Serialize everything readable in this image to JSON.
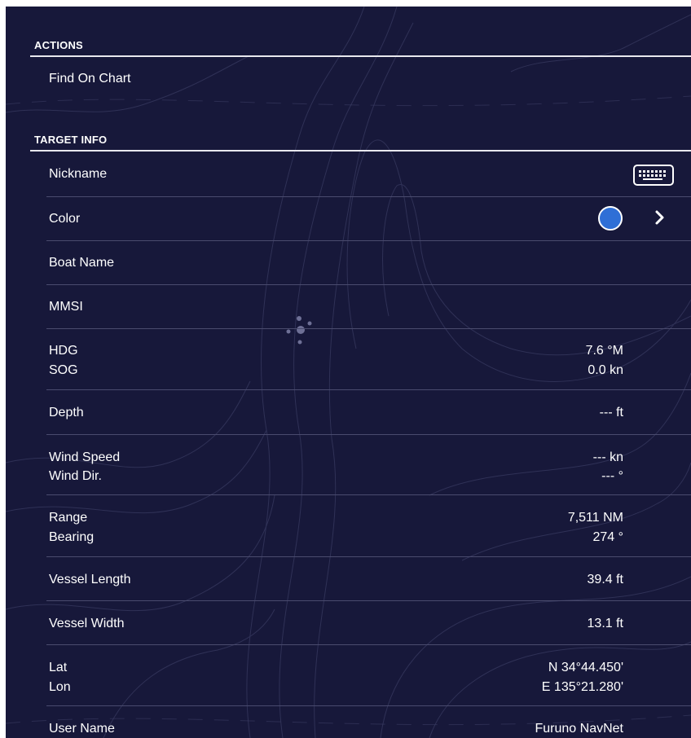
{
  "sections": {
    "actions": "ACTIONS",
    "target_info": "TARGET INFO"
  },
  "actions": {
    "find_on_chart": "Find On Chart"
  },
  "target_info": {
    "nickname": "Nickname",
    "color": "Color",
    "color_value": "#2f6fd6",
    "boat_name": "Boat Name",
    "mmsi": "MMSI",
    "hdg_label": "HDG",
    "hdg_value": "7.6 °M",
    "sog_label": "SOG",
    "sog_value": "0.0 kn",
    "depth_label": "Depth",
    "depth_value": "--- ft",
    "wind_speed_label": "Wind Speed",
    "wind_speed_value": "--- kn",
    "wind_dir_label": "Wind Dir.",
    "wind_dir_value": "--- °",
    "range_label": "Range",
    "range_value": "7,511 NM",
    "bearing_label": "Bearing",
    "bearing_value": "274 °",
    "vessel_length_label": "Vessel Length",
    "vessel_length_value": "39.4 ft",
    "vessel_width_label": "Vessel Width",
    "vessel_width_value": "13.1 ft",
    "lat_label": "Lat",
    "lat_value": "N 34°44.450'",
    "lon_label": "Lon",
    "lon_value": "E 135°21.280'",
    "user_name_label": "User Name",
    "user_name_value": "Furuno NavNet"
  },
  "icons": {
    "keyboard": "keyboard-icon",
    "chevron": "chevron-right-icon",
    "spinner": "loading-spinner-icon"
  },
  "colors": {
    "background": "#17183a",
    "divider": "#4a4b6e",
    "section_line": "#e8e8ee",
    "text": "#ffffff"
  }
}
